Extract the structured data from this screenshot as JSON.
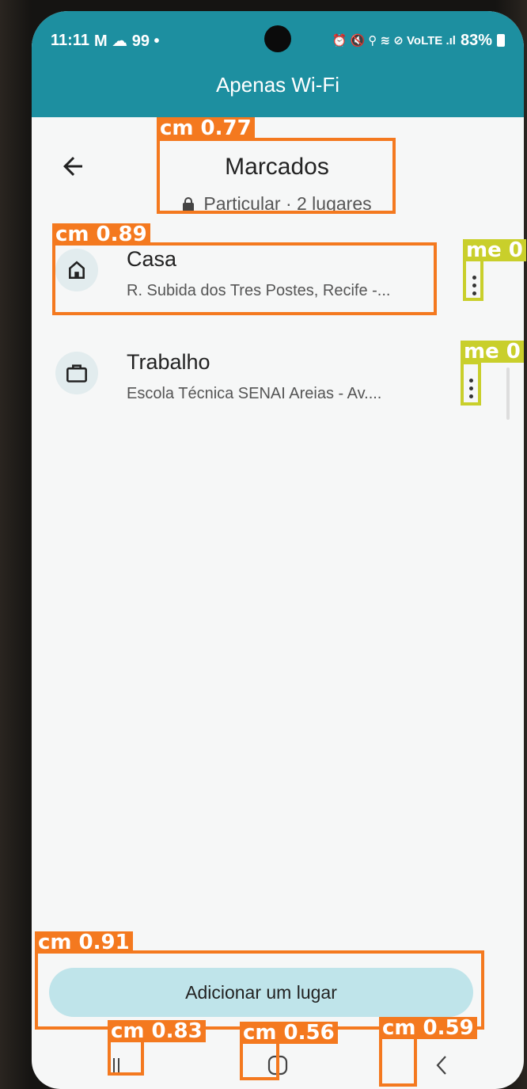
{
  "status": {
    "time": "11:11",
    "left_icons": "M ☁ 99 •",
    "right_icons": "⏰ 🔇 ⚲ ≋ ⊘ VoLTE .ıl",
    "battery": "83%"
  },
  "connection_banner": "Apenas Wi-Fi",
  "header": {
    "title": "Marcados",
    "privacy": "Particular",
    "count": "2 lugares",
    "separator": "·"
  },
  "places": [
    {
      "name": "Casa",
      "address": "R. Subida dos Tres Postes, Recife -...",
      "icon": "home-icon"
    },
    {
      "name": "Trabalho",
      "address": "Escola Técnica SENAI Areias - Av....",
      "icon": "briefcase-icon"
    }
  ],
  "add_button": "Adicionar um lugar",
  "detections": [
    {
      "label": "cm 0.77",
      "color": "#f4791f"
    },
    {
      "label": "cm 0.89",
      "color": "#f4791f"
    },
    {
      "label": "me 0",
      "color": "#c9cf2b"
    },
    {
      "label": "me 0",
      "color": "#c9cf2b"
    },
    {
      "label": "cm 0.91",
      "color": "#f4791f"
    },
    {
      "label": "cm 0.83",
      "color": "#f4791f"
    },
    {
      "label": "cm 0.56",
      "color": "#f4791f"
    },
    {
      "label": "cm 0.59",
      "color": "#f4791f"
    }
  ],
  "colors": {
    "accent": "#1d8fa0",
    "button": "#bfe4ea",
    "detection": "#f4791f",
    "detection_alt": "#c9cf2b"
  }
}
